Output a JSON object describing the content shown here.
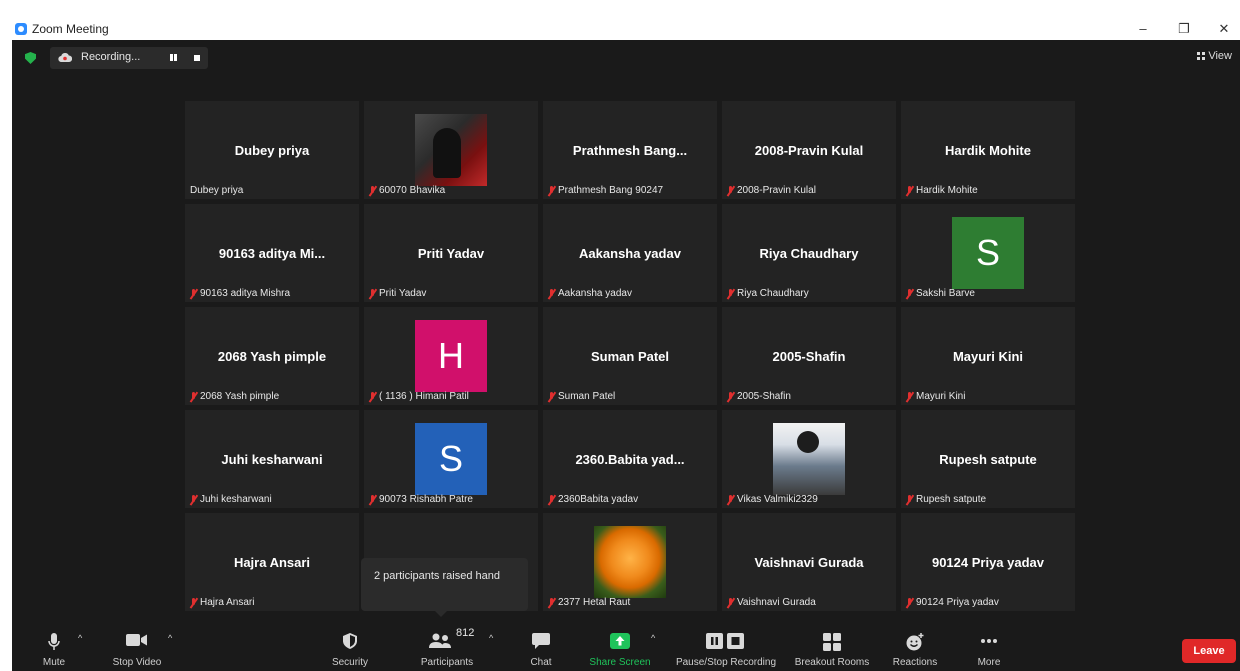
{
  "window": {
    "title": "Zoom Meeting",
    "min": "–",
    "max": "❐",
    "close": "✕"
  },
  "topbar": {
    "recording_label": "Recording...",
    "view_label": "View"
  },
  "tiles": [
    {
      "title": "Dubey priya",
      "label": "Dubey priya",
      "muted": false,
      "avatar": "none"
    },
    {
      "title": "",
      "label": "60070 Bhavika",
      "muted": true,
      "avatar": "photo-anime"
    },
    {
      "title": "Prathmesh  Bang...",
      "label": "Prathmesh Bang 90247",
      "muted": true,
      "avatar": "none"
    },
    {
      "title": "2008-Pravin Kulal",
      "label": "2008-Pravin Kulal",
      "muted": true,
      "avatar": "none"
    },
    {
      "title": "Hardik Mohite",
      "label": "Hardik Mohite",
      "muted": true,
      "avatar": "none"
    },
    {
      "title": "90163 aditya Mi...",
      "label": "90163 aditya Mishra",
      "muted": true,
      "avatar": "none"
    },
    {
      "title": "Priti Yadav",
      "label": "Priti Yadav",
      "muted": true,
      "avatar": "none"
    },
    {
      "title": "Aakansha yadav",
      "label": "Aakansha yadav",
      "muted": true,
      "avatar": "none"
    },
    {
      "title": "Riya Chaudhary",
      "label": "Riya Chaudhary",
      "muted": true,
      "avatar": "none"
    },
    {
      "title": "",
      "label": "Sakshi Barve",
      "muted": true,
      "avatar": "letter",
      "letter": "S",
      "color": "#2e7d32"
    },
    {
      "title": "2068 Yash pimple",
      "label": "2068 Yash pimple",
      "muted": true,
      "avatar": "none"
    },
    {
      "title": "",
      "label": "( 1136 ) Himani Patil",
      "muted": true,
      "avatar": "letter",
      "letter": "H",
      "color": "#d1106b"
    },
    {
      "title": "Suman Patel",
      "label": "Suman Patel",
      "muted": true,
      "avatar": "none"
    },
    {
      "title": "2005-Shafin",
      "label": "2005-Shafin",
      "muted": true,
      "avatar": "none"
    },
    {
      "title": "Mayuri Kini",
      "label": "Mayuri Kini",
      "muted": true,
      "avatar": "none"
    },
    {
      "title": "Juhi kesharwani",
      "label": "Juhi kesharwani",
      "muted": true,
      "avatar": "none"
    },
    {
      "title": "",
      "label": "90073 Rishabh Patre",
      "muted": true,
      "avatar": "letter",
      "letter": "S",
      "color": "#2361b8"
    },
    {
      "title": "2360.Babita  yad...",
      "label": "2360Babita yadav",
      "muted": true,
      "avatar": "none"
    },
    {
      "title": "",
      "label": "Vikas Valmiki2329",
      "muted": true,
      "avatar": "photo-person"
    },
    {
      "title": "Rupesh satpute",
      "label": "Rupesh satpute",
      "muted": true,
      "avatar": "none"
    },
    {
      "title": "Hajra Ansari",
      "label": "Hajra Ansari",
      "muted": true,
      "avatar": "none"
    },
    {
      "title": "",
      "label": "",
      "muted": false,
      "avatar": "none"
    },
    {
      "title": "",
      "label": "2377 Hetal Raut",
      "muted": true,
      "avatar": "photo-flower"
    },
    {
      "title": "Vaishnavi Gurada",
      "label": "Vaishnavi Gurada",
      "muted": true,
      "avatar": "none"
    },
    {
      "title": "90124 Priya yadav",
      "label": "90124 Priya yadav",
      "muted": true,
      "avatar": "none"
    }
  ],
  "tooltip": "2 participants raised hand",
  "toolbar": {
    "mute": "Mute",
    "stop_video": "Stop Video",
    "security": "Security",
    "participants": "Participants",
    "participant_count": "812",
    "chat": "Chat",
    "share_screen": "Share Screen",
    "pause_stop_recording": "Pause/Stop Recording",
    "breakout_rooms": "Breakout Rooms",
    "reactions": "Reactions",
    "more": "More",
    "leave": "Leave",
    "caret": "^"
  },
  "colors": {
    "meeting_bg": "#1a1a1a",
    "tile_bg": "#232323",
    "share_green": "#1fc35b",
    "leave_red": "#e02828",
    "muted_red": "#e02f2f"
  }
}
